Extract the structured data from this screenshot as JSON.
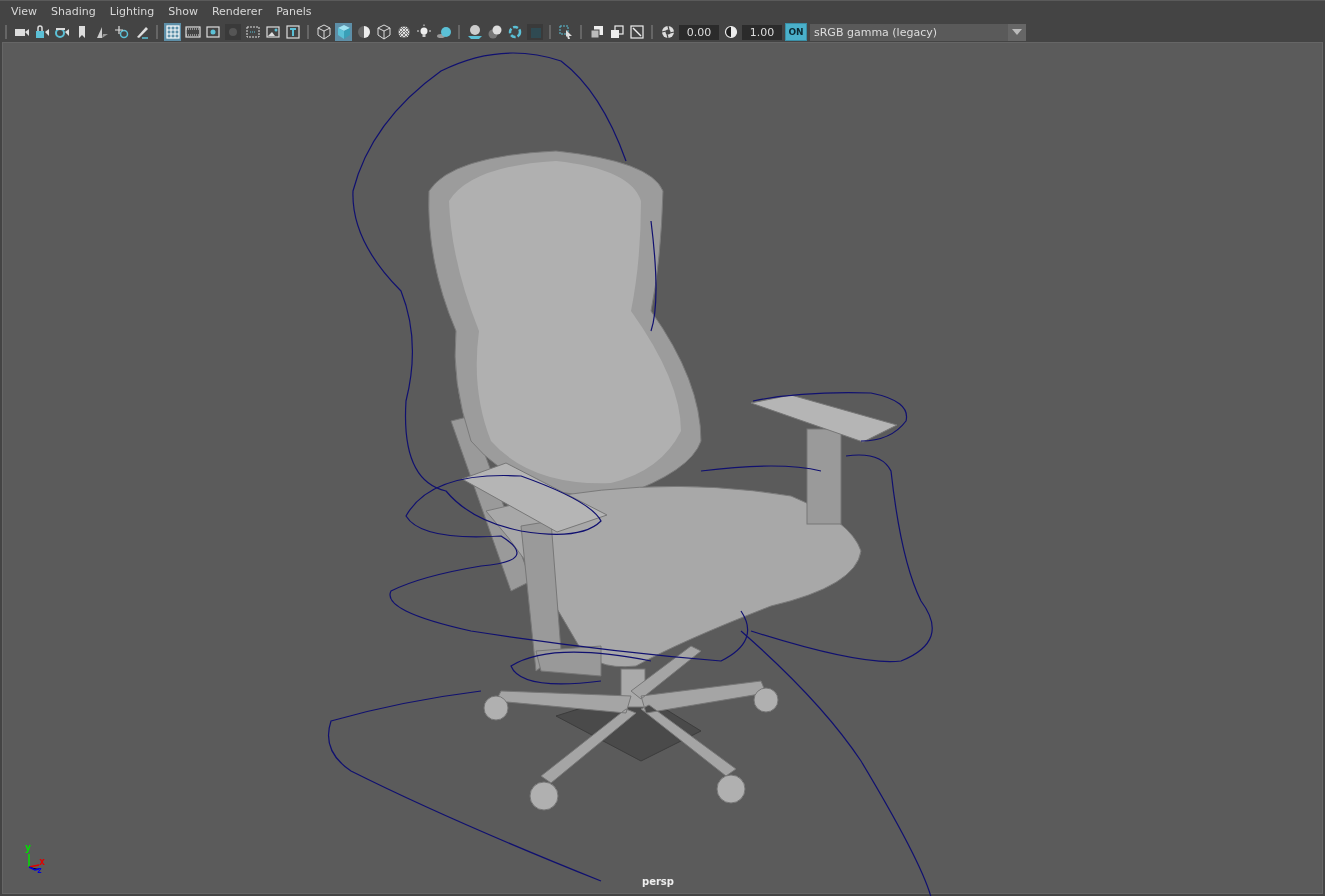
{
  "menu": [
    "View",
    "Shading",
    "Lighting",
    "Show",
    "Renderer",
    "Panels"
  ],
  "toolbar": {
    "groups": [
      [
        {
          "kind": "camera",
          "selected": false
        },
        {
          "kind": "camera-lock",
          "selected": false
        },
        {
          "kind": "camera-gear",
          "selected": false
        },
        {
          "kind": "bookmark",
          "selected": false
        },
        {
          "kind": "image-plane",
          "selected": false
        },
        {
          "kind": "zoom",
          "selected": false
        },
        {
          "kind": "pencil",
          "selected": false
        }
      ],
      [
        {
          "kind": "grid",
          "selected": true
        },
        {
          "kind": "film",
          "selected": false
        },
        {
          "kind": "dot-frame",
          "selected": false
        },
        {
          "kind": "dark-circle",
          "selected": false
        },
        {
          "kind": "dashed-frame",
          "selected": false
        },
        {
          "kind": "picture",
          "selected": false
        },
        {
          "kind": "text-frame",
          "selected": false
        }
      ],
      [
        {
          "kind": "wire-cube",
          "selected": false
        },
        {
          "kind": "solid-cube",
          "selected": true
        },
        {
          "kind": "half-sphere",
          "selected": false
        },
        {
          "kind": "wire-cube",
          "selected": false
        },
        {
          "kind": "textured-sphere",
          "selected": false
        },
        {
          "kind": "bulb",
          "selected": false
        },
        {
          "kind": "shadow-ball",
          "selected": false
        }
      ],
      [
        {
          "kind": "ground-sphere",
          "selected": false
        },
        {
          "kind": "blur-sphere",
          "selected": false
        },
        {
          "kind": "ring",
          "selected": false
        },
        {
          "kind": "dark-square",
          "selected": false
        }
      ],
      [
        {
          "kind": "select",
          "selected": false
        }
      ],
      [
        {
          "kind": "overlap",
          "selected": false
        },
        {
          "kind": "overlap-outline",
          "selected": false
        },
        {
          "kind": "arrow-box",
          "selected": false
        }
      ]
    ],
    "exposure": {
      "value": "0.00"
    },
    "gamma": {
      "value": "1.00"
    },
    "color_management": {
      "label": "ON",
      "on": true
    },
    "color_space": {
      "value": "sRGB gamma (legacy)"
    }
  },
  "viewport": {
    "camera": "persp",
    "axes": {
      "x": "x",
      "y": "y",
      "z": "z"
    }
  }
}
